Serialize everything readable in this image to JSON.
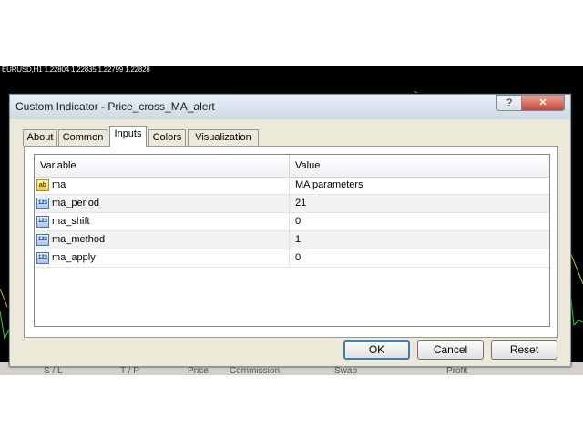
{
  "chart": {
    "symbol_info": "EURUSD,H1  1.22804 1.22835 1.22799 1.22828",
    "bottom_columns": [
      "S / L",
      "T / P",
      "Price",
      "Commission",
      "Swap",
      "Profit"
    ]
  },
  "dialog": {
    "title": "Custom Indicator - Price_cross_MA_alert",
    "help_label": "?",
    "close_label": "✕",
    "tabs": [
      {
        "label": "About"
      },
      {
        "label": "Common"
      },
      {
        "label": "Inputs",
        "active": true
      },
      {
        "label": "Colors"
      },
      {
        "label": "Visualization"
      }
    ],
    "table": {
      "headers": {
        "variable": "Variable",
        "value": "Value"
      },
      "rows": [
        {
          "icon": "ab",
          "variable": "ma",
          "value": "MA parameters"
        },
        {
          "icon": "123",
          "variable": "ma_period",
          "value": "21"
        },
        {
          "icon": "123",
          "variable": "ma_shift",
          "value": "0"
        },
        {
          "icon": "123",
          "variable": "ma_method",
          "value": "1"
        },
        {
          "icon": "123",
          "variable": "ma_apply",
          "value": "0"
        }
      ]
    },
    "buttons": {
      "ok": "OK",
      "cancel": "Cancel",
      "reset": "Reset"
    }
  },
  "colors": {
    "accent": "#3c7fb1",
    "close": "#c5463a",
    "dialog_bg": "#ece9d8"
  }
}
